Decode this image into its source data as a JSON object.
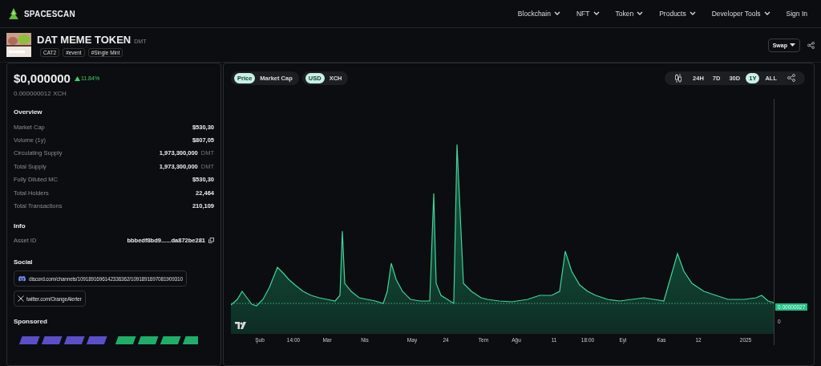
{
  "brand": "SPACESCAN",
  "nav": [
    {
      "label": "Blockchain",
      "menu": true
    },
    {
      "label": "NFT",
      "menu": true
    },
    {
      "label": "Token",
      "menu": true
    },
    {
      "label": "Products",
      "menu": true
    },
    {
      "label": "Developer Tools",
      "menu": true
    },
    {
      "label": "Sign In",
      "menu": false
    }
  ],
  "token": {
    "name": "DAT MEME TOKEN",
    "symbol": "DMT",
    "tags": [
      "CAT2",
      "#event",
      "#Single Mint"
    ],
    "swap": "Swap"
  },
  "price": {
    "usd": "$0,000000",
    "change": "11.84%",
    "xch": "0.000000012 XCH"
  },
  "overview": {
    "title": "Overview",
    "rows": [
      {
        "label": "Market Cap",
        "value": "$530,30"
      },
      {
        "label": "Volume (1y)",
        "value": "$807,05"
      },
      {
        "label": "Circulating Supply",
        "value": "1,973,300,000",
        "unit": "DMT"
      },
      {
        "label": "Total Supply",
        "value": "1,973,300,000",
        "unit": "DMT"
      },
      {
        "label": "Fully Diluted MC",
        "value": "$530,30"
      },
      {
        "label": "Total Holders",
        "value": "22,464"
      },
      {
        "label": "Total Transactions",
        "value": "210,109"
      }
    ]
  },
  "info": {
    "title": "Info",
    "label": "Asset ID",
    "value": "bbbedf8bd9......da872be281"
  },
  "social": {
    "title": "Social",
    "links": [
      {
        "kind": "discord",
        "label": "discord.com/channels/1091891696142336362/1091891697081909310"
      },
      {
        "kind": "x",
        "label": "twitter.com/OrangeAlerter"
      }
    ]
  },
  "sponsored": {
    "title": "Sponsored"
  },
  "chart": {
    "metric": [
      {
        "label": "Price",
        "selected": true
      },
      {
        "label": "Market Cap",
        "selected": false
      }
    ],
    "currency": [
      {
        "label": "USD",
        "selected": true
      },
      {
        "label": "XCH",
        "selected": false
      }
    ],
    "periods": [
      {
        "label": "24H",
        "selected": false
      },
      {
        "label": "7D",
        "selected": false
      },
      {
        "label": "30D",
        "selected": false
      },
      {
        "label": "1Y",
        "selected": true
      },
      {
        "label": "ALL",
        "selected": false
      }
    ],
    "last_price": "0.00000027",
    "y_zero": "0",
    "x_labels": [
      "Şub",
      "14:00",
      "Mar",
      "Nis",
      "May",
      "24",
      "Tem",
      "Ağu",
      "11",
      "18:00",
      "Eyl",
      "Kas",
      "12",
      "2025"
    ]
  }
}
